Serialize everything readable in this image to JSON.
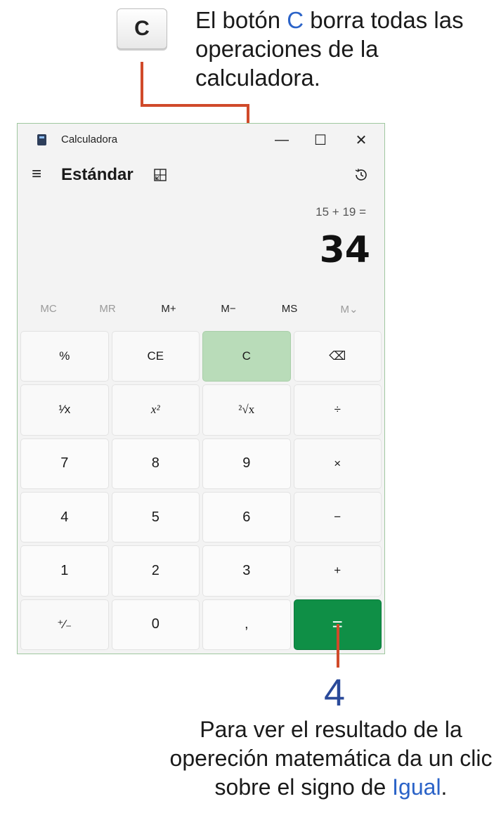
{
  "callout_top": {
    "button_label": "C",
    "text_before": "El botón ",
    "text_highlight": "C",
    "text_after": " borra todas las operaciones de la calculadora."
  },
  "window": {
    "title": "Calculadora",
    "minimize": "—",
    "maximize": "☐",
    "close": "✕"
  },
  "header": {
    "menu_icon": "≡",
    "mode": "Estándar"
  },
  "display": {
    "expression": "15 + 19 =",
    "result": "34"
  },
  "memory": [
    "MC",
    "MR",
    "M+",
    "M−",
    "MS",
    "M⌄"
  ],
  "keys": {
    "percent": "%",
    "ce": "CE",
    "c": "C",
    "backspace": "⌫",
    "reciprocal": "¹⁄x",
    "square": "x²",
    "sqrt": "²√x",
    "divide": "÷",
    "seven": "7",
    "eight": "8",
    "nine": "9",
    "multiply": "×",
    "four": "4",
    "five": "5",
    "six": "6",
    "minus": "−",
    "one": "1",
    "two": "2",
    "three": "3",
    "plus": "+",
    "negate": "⁺∕₋",
    "zero": "0",
    "decimal": ",",
    "equals": "="
  },
  "callout_bottom": {
    "number": "4",
    "text_before": "Para ver el resultado de la opereción matemática da un clic sobre el signo de ",
    "text_highlight": "Igual",
    "text_after": "."
  },
  "colors": {
    "accent": "#0f8f46",
    "highlight": "#b9dcb9",
    "callout_line": "#d04a2a",
    "callout_blue": "#2b63c8"
  }
}
